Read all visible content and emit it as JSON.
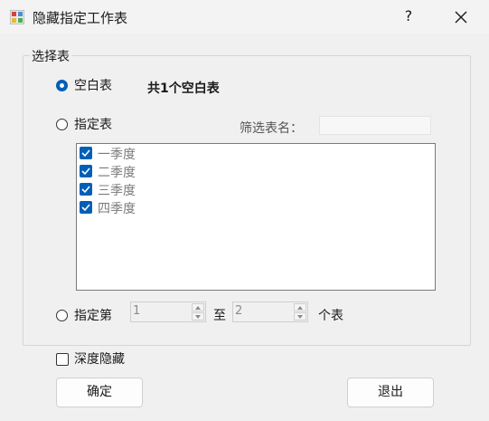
{
  "window": {
    "title": "隐藏指定工作表",
    "help_label": "?"
  },
  "group": {
    "legend": "选择表"
  },
  "options": {
    "blank_label": "空白表",
    "blank_summary": "共1个空白表",
    "specified_label": "指定表",
    "filter_label": "筛选表名：",
    "filter_value": "",
    "range_label": "指定第",
    "range_from": "1",
    "range_to_label": "至",
    "range_to": "2",
    "range_unit": "个表"
  },
  "sheets": [
    {
      "label": "一季度",
      "checked": true
    },
    {
      "label": "二季度",
      "checked": true
    },
    {
      "label": "三季度",
      "checked": true
    },
    {
      "label": "四季度",
      "checked": true
    }
  ],
  "deep_hide_label": "深度隐藏",
  "buttons": {
    "ok": "确定",
    "exit": "退出"
  },
  "colors": {
    "accent": "#005fb8"
  }
}
